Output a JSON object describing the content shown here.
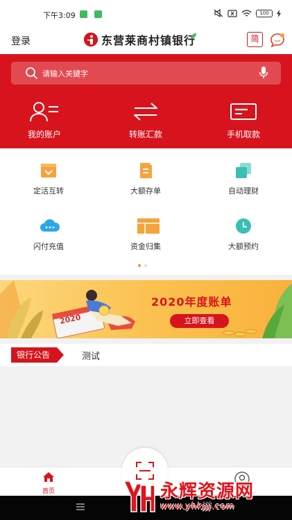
{
  "status_bar": {
    "time": "下午3:09",
    "battery": "100"
  },
  "header": {
    "login": "登录",
    "bank_name": "东营莱商村镇银行",
    "simplified_toggle": "简"
  },
  "search": {
    "placeholder": "请输入关键字"
  },
  "quick_actions": [
    {
      "label": "我的账户",
      "icon": "user-list-icon"
    },
    {
      "label": "转账汇款",
      "icon": "transfer-arrows-icon"
    },
    {
      "label": "手机取款",
      "icon": "card-icon"
    }
  ],
  "services": [
    {
      "label": "定活互转",
      "icon": "swap-box-icon",
      "color": "#f5a33b"
    },
    {
      "label": "大额存单",
      "icon": "document-icon",
      "color": "#f5a33b"
    },
    {
      "label": "自动理财",
      "icon": "stacked-squares-icon",
      "color": "#3bbfb5"
    },
    {
      "label": "闪付充值",
      "icon": "cloud-icon",
      "color": "#2aa8e8"
    },
    {
      "label": "资金归集",
      "icon": "layout-icon",
      "color": "#f5a33b"
    },
    {
      "label": "大额预约",
      "icon": "clock-icon",
      "color": "#3bbfb5"
    }
  ],
  "pager": {
    "pages": 2,
    "active": 0
  },
  "promo": {
    "title": "2020年度账单",
    "button": "立即查看",
    "calendar_text": "2020"
  },
  "notice": {
    "tag": "银行公告",
    "text": "测试"
  },
  "tabbar": {
    "home": "首页"
  },
  "watermark": {
    "title": "永辉资源网",
    "url": "www.yhkjjj.com"
  },
  "colors": {
    "brand_red": "#d7141d",
    "accent_orange": "#f4901d",
    "teal": "#3bbfb5",
    "blue": "#2aa8e8"
  }
}
